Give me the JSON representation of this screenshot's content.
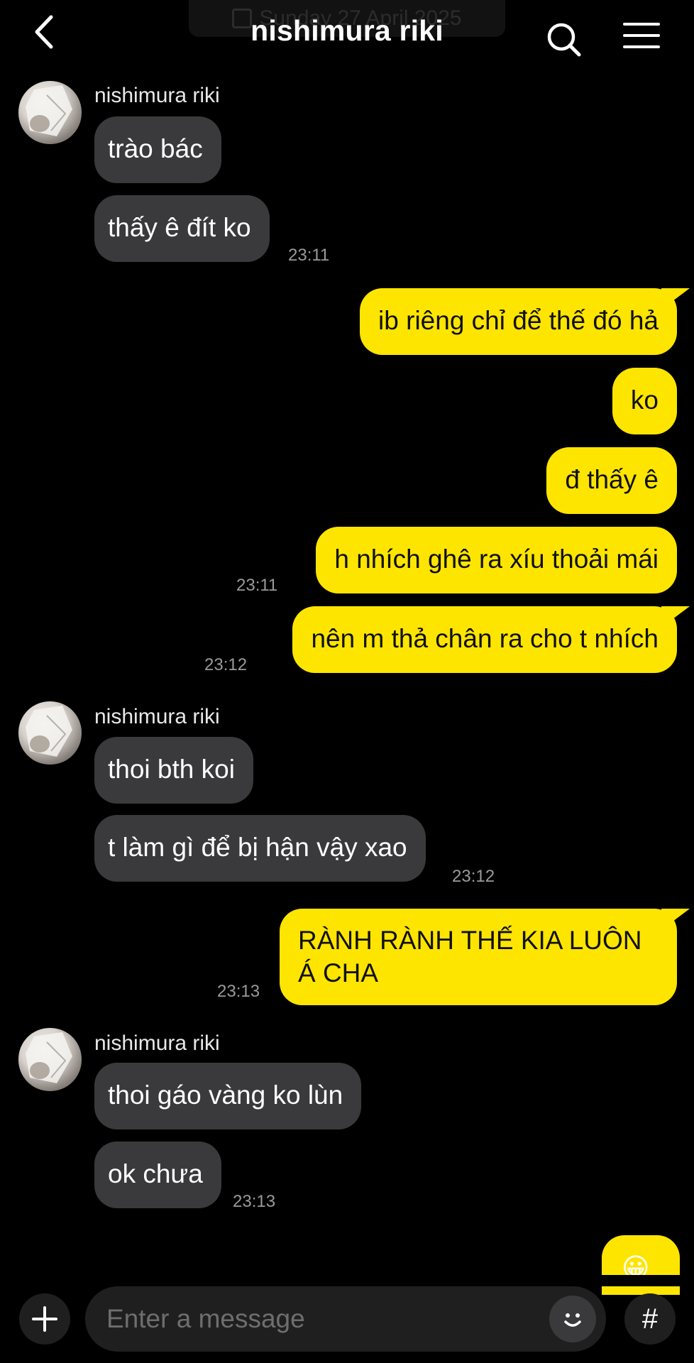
{
  "header": {
    "title": "nishimura riki",
    "date_label": "Sunday 27 April 2025"
  },
  "messages": [
    {
      "sender": "nishimura riki",
      "bubbles": [
        "trào bác",
        "thấy ê đít ko"
      ],
      "time": "23:11"
    },
    {
      "out": [
        "ib riêng chỉ để thế đó hả",
        "ko",
        "đ thấy ê",
        "h nhích ghê ra xíu thoải mái"
      ],
      "time": "23:11"
    },
    {
      "out": [
        "nên m thả chân ra cho t nhích"
      ],
      "time": "23:12"
    },
    {
      "sender": "nishimura riki",
      "bubbles": [
        "thoi bth koi",
        "t làm gì để bị hận vậy xao"
      ],
      "time": "23:12"
    },
    {
      "out": [
        "RÀNH RÀNH THẾ KIA LUÔN Á CHA"
      ],
      "time": "23:13"
    },
    {
      "sender": "nishimura riki",
      "bubbles": [
        "thoi gáo vàng ko lùn",
        "ok chưa"
      ],
      "time": "23:13"
    }
  ],
  "partial_emoji": "😀",
  "composer": {
    "placeholder": "Enter a message",
    "hash_label": "#"
  },
  "colors": {
    "background": "#000000",
    "incoming_bubble": "#3a3a3c",
    "outgoing_bubble": "#fee500"
  }
}
